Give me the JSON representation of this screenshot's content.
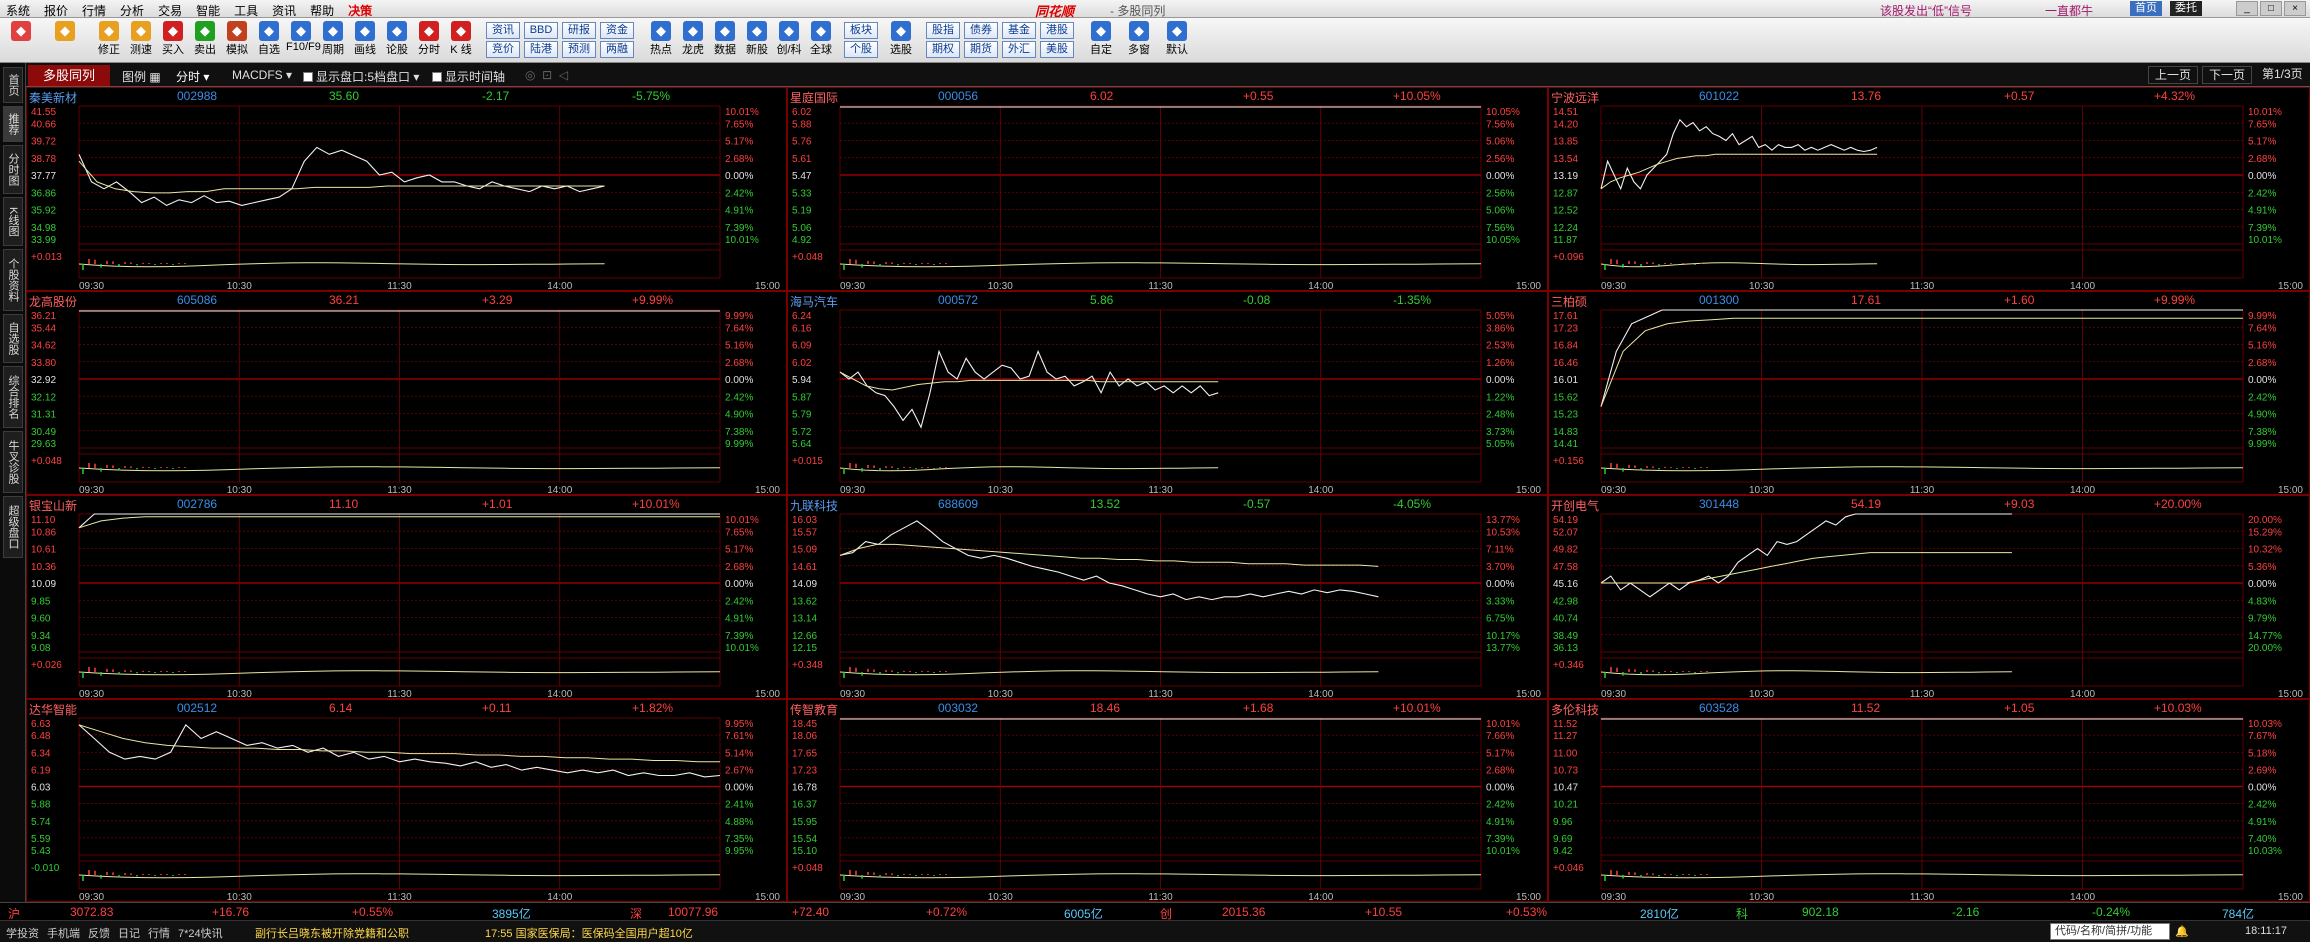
{
  "menubar": {
    "items": [
      "系统",
      "报价",
      "行情",
      "分析",
      "交易",
      "智能",
      "工具",
      "资讯",
      "帮助",
      "决策"
    ],
    "brand": "同花顺",
    "title": "- 多股同列",
    "alert": "该股发出“低”信号",
    "alert2": "一直都牛",
    "chip1": "首页",
    "chip2": "委托"
  },
  "toolbar": {
    "icons": [
      {
        "label": "",
        "name": "color-grid-icon"
      },
      {
        "label": "",
        "name": "back-arrow-icon"
      },
      {
        "label": "修正",
        "name": "fix-icon"
      },
      {
        "label": "测速",
        "name": "speed-test-icon"
      },
      {
        "label": "买入",
        "name": "buy-icon"
      },
      {
        "label": "卖出",
        "name": "sell-icon"
      },
      {
        "label": "模拟",
        "name": "simulate-icon"
      },
      {
        "label": "自选",
        "name": "watchlist-icon"
      },
      {
        "label": "F10/F9",
        "name": "f10-icon"
      },
      {
        "label": "周期",
        "name": "period-icon"
      },
      {
        "label": "画线",
        "name": "draw-line-icon"
      },
      {
        "label": "论股",
        "name": "discuss-icon"
      },
      {
        "label": "分时",
        "name": "intraday-icon"
      },
      {
        "label": "K 线",
        "name": "kline-icon"
      }
    ],
    "boxes1": [
      "资讯",
      "竞价",
      "BBD",
      "陆港",
      "研报",
      "预测",
      "资金",
      "两融"
    ],
    "icons2": [
      {
        "label": "热点",
        "name": "hot-icon"
      },
      {
        "label": "龙虎",
        "name": "dragon-tiger-icon"
      },
      {
        "label": "数据",
        "name": "data-icon"
      },
      {
        "label": "新股",
        "name": "new-stock-icon"
      },
      {
        "label": "创/科",
        "name": "chuang-ke-icon"
      },
      {
        "label": "全球",
        "name": "global-icon"
      }
    ],
    "boxes2": [
      "板块",
      "个股"
    ],
    "xuangu": "选股",
    "boxes3": [
      "股指",
      "期权",
      "债券",
      "期货",
      "基金",
      "外汇",
      "港股",
      "美股"
    ],
    "icons3": [
      {
        "label": "自定",
        "name": "custom-icon"
      },
      {
        "label": "多窗",
        "name": "multi-window-icon"
      },
      {
        "label": "默认",
        "name": "default-home-icon"
      }
    ]
  },
  "tabbar": {
    "main_tab": "多股同列",
    "layout": "图例",
    "period": "分时",
    "indicator": "MACDFS",
    "opt1": "显示盘口:5档盘口",
    "opt2": "显示时间轴",
    "prev": "上一页",
    "next": "下一页",
    "page": "第1/3页"
  },
  "sidebar": [
    "首页",
    "推荐",
    "分时图",
    "K线图",
    "个股资料",
    "自选股",
    "综合排名",
    "牛叉诊股",
    "超级盘口"
  ],
  "time_labels": [
    "09:30",
    "10:30",
    "11:30",
    "14:00",
    "15:00"
  ],
  "colors": {
    "up": "#ff4040",
    "down": "#33cc33",
    "neutral": "#e0e0e0",
    "code": "#3a8ee6",
    "name": "#5a9bf0",
    "grid": "#7a0000"
  },
  "stocks": [
    {
      "name": "秦美新材",
      "code": "002988",
      "price": "35.60",
      "change": "-2.17",
      "pct": "-5.75%",
      "ticks": [
        "41.55",
        "40.66",
        "39.72",
        "38.78",
        "37.77",
        "36.86",
        "35.92",
        "34.98",
        "33.99"
      ],
      "pcts": [
        "10.01%",
        "7.65%",
        "5.17%",
        "2.68%",
        "0.00%",
        "2.42%",
        "4.91%",
        "7.39%",
        "10.01%"
      ],
      "vol": "+0.013",
      "color": "down",
      "shape": [
        0.35,
        0.55,
        0.6,
        0.55,
        0.62,
        0.7,
        0.66,
        0.72,
        0.68,
        0.7,
        0.65,
        0.7,
        0.69,
        0.72,
        0.7,
        0.68,
        0.66,
        0.6,
        0.4,
        0.3,
        0.35,
        0.32,
        0.36,
        0.4,
        0.5,
        0.48,
        0.55,
        0.52,
        0.5,
        0.55,
        0.55,
        0.58,
        0.6,
        0.55,
        0.58,
        0.6,
        0.62,
        0.58,
        0.6,
        0.58,
        0.62,
        0.6,
        0.58
      ],
      "avg": [
        0.4,
        0.55,
        0.6,
        0.62,
        0.63,
        0.63,
        0.62,
        0.62,
        0.6,
        0.6,
        0.6,
        0.6,
        0.6,
        0.59,
        0.59,
        0.59,
        0.59,
        0.58,
        0.58,
        0.58,
        0.58,
        0.58,
        0.58,
        0.58,
        0.58,
        0.58,
        0.58,
        0.58,
        0.58,
        0.58
      ],
      "end": 0.82
    },
    {
      "name": "星庭国际",
      "code": "000056",
      "price": "6.02",
      "change": "+0.55",
      "pct": "+10.05%",
      "ticks": [
        "6.02",
        "5.88",
        "5.76",
        "5.61",
        "5.47",
        "5.33",
        "5.19",
        "5.06",
        "4.92"
      ],
      "pcts": [
        "10.05%",
        "7.56%",
        "5.06%",
        "2.56%",
        "0.00%",
        "2.56%",
        "5.06%",
        "7.56%",
        "10.05%"
      ],
      "vol": "+0.048",
      "color": "up",
      "shape": [],
      "avg": [],
      "end": 1
    },
    {
      "name": "宁波远洋",
      "code": "601022",
      "price": "13.76",
      "change": "+0.57",
      "pct": "+4.32%",
      "ticks": [
        "14.51",
        "14.20",
        "13.85",
        "13.54",
        "13.19",
        "12.87",
        "12.52",
        "12.24",
        "11.87"
      ],
      "pcts": [
        "10.01%",
        "7.65%",
        "5.17%",
        "2.68%",
        "0.00%",
        "2.42%",
        "4.91%",
        "7.39%",
        "10.01%"
      ],
      "vol": "+0.096",
      "color": "up",
      "shape": [
        0.6,
        0.4,
        0.5,
        0.6,
        0.45,
        0.55,
        0.6,
        0.5,
        0.45,
        0.4,
        0.35,
        0.2,
        0.1,
        0.15,
        0.12,
        0.18,
        0.15,
        0.2,
        0.22,
        0.25,
        0.2,
        0.28,
        0.25,
        0.22,
        0.3,
        0.28,
        0.32,
        0.28,
        0.3,
        0.3,
        0.28,
        0.32,
        0.3,
        0.32,
        0.3,
        0.28,
        0.3,
        0.32,
        0.3,
        0.32,
        0.33,
        0.32,
        0.3
      ],
      "avg": [
        0.6,
        0.55,
        0.52,
        0.5,
        0.48,
        0.45,
        0.42,
        0.4,
        0.38,
        0.37,
        0.36,
        0.36,
        0.35,
        0.35,
        0.35,
        0.35,
        0.35,
        0.35,
        0.35,
        0.35,
        0.35,
        0.35,
        0.35,
        0.35,
        0.35,
        0.35,
        0.35,
        0.35,
        0.35,
        0.35
      ],
      "end": 0.43
    },
    {
      "name": "龙高股份",
      "code": "605086",
      "price": "36.21",
      "change": "+3.29",
      "pct": "+9.99%",
      "ticks": [
        "36.21",
        "35.44",
        "34.62",
        "33.80",
        "32.92",
        "32.12",
        "31.31",
        "30.49",
        "29.63"
      ],
      "pcts": [
        "9.99%",
        "7.64%",
        "5.16%",
        "2.68%",
        "0.00%",
        "2.42%",
        "4.90%",
        "7.38%",
        "9.99%"
      ],
      "vol": "+0.048",
      "color": "up",
      "shape": [],
      "avg": [],
      "end": 1
    },
    {
      "name": "海马汽车",
      "code": "000572",
      "price": "5.86",
      "change": "-0.08",
      "pct": "-1.35%",
      "ticks": [
        "6.24",
        "6.16",
        "6.09",
        "6.02",
        "5.94",
        "5.87",
        "5.79",
        "5.72",
        "5.64"
      ],
      "pcts": [
        "5.05%",
        "3.86%",
        "2.53%",
        "1.26%",
        "0.00%",
        "1.22%",
        "2.48%",
        "3.73%",
        "5.05%"
      ],
      "vol": "+0.015",
      "color": "down",
      "shape": [
        0.45,
        0.5,
        0.45,
        0.55,
        0.6,
        0.62,
        0.7,
        0.8,
        0.72,
        0.85,
        0.6,
        0.3,
        0.45,
        0.5,
        0.35,
        0.45,
        0.5,
        0.45,
        0.4,
        0.42,
        0.5,
        0.48,
        0.3,
        0.45,
        0.5,
        0.48,
        0.55,
        0.52,
        0.48,
        0.6,
        0.45,
        0.55,
        0.5,
        0.55,
        0.52,
        0.58,
        0.55,
        0.6,
        0.55,
        0.6,
        0.55,
        0.62,
        0.6
      ],
      "avg": [
        0.45,
        0.5,
        0.55,
        0.57,
        0.58,
        0.56,
        0.54,
        0.53,
        0.52,
        0.52,
        0.51,
        0.51,
        0.51,
        0.51,
        0.51,
        0.51,
        0.51,
        0.51,
        0.51,
        0.51,
        0.52,
        0.52,
        0.52,
        0.52,
        0.52,
        0.52,
        0.52,
        0.52,
        0.52,
        0.52
      ],
      "end": 0.59
    },
    {
      "name": "三柏硕",
      "code": "001300",
      "price": "17.61",
      "change": "+1.60",
      "pct": "+9.99%",
      "ticks": [
        "17.61",
        "17.23",
        "16.84",
        "16.46",
        "16.01",
        "15.62",
        "15.23",
        "14.83",
        "14.41"
      ],
      "pcts": [
        "9.99%",
        "7.64%",
        "5.16%",
        "2.68%",
        "0.00%",
        "2.42%",
        "4.90%",
        "7.38%",
        "9.99%"
      ],
      "vol": "+0.156",
      "color": "up",
      "shape": [
        0.7,
        0.3,
        0.1,
        0.05,
        0.0,
        0.0,
        0.0,
        0.0,
        0.0,
        0.0,
        0.0,
        0.0,
        0.0,
        0.0,
        0.0,
        0.0,
        0.0,
        0.0,
        0.0,
        0.0,
        0.0,
        0.0,
        0.0,
        0.0,
        0.0,
        0.0,
        0.0,
        0.0,
        0.0,
        0.0,
        0.0,
        0.0,
        0.0,
        0.0,
        0.0,
        0.0,
        0.0,
        0.0,
        0.0,
        0.0,
        0.0,
        0.0,
        0.0
      ],
      "avg": [
        0.7,
        0.3,
        0.15,
        0.1,
        0.08,
        0.07,
        0.06,
        0.06,
        0.06,
        0.06,
        0.06,
        0.06,
        0.06,
        0.06,
        0.06,
        0.06,
        0.06,
        0.06,
        0.06,
        0.06,
        0.06,
        0.06,
        0.06,
        0.06,
        0.06,
        0.06,
        0.06,
        0.06,
        0.06,
        0.06
      ],
      "end": 1
    },
    {
      "name": "银宝山新",
      "code": "002786",
      "price": "11.10",
      "change": "+1.01",
      "pct": "+10.01%",
      "ticks": [
        "11.10",
        "10.86",
        "10.61",
        "10.36",
        "10.09",
        "9.85",
        "9.60",
        "9.34",
        "9.08"
      ],
      "pcts": [
        "10.01%",
        "7.65%",
        "5.17%",
        "2.68%",
        "0.00%",
        "2.42%",
        "4.91%",
        "7.39%",
        "10.01%"
      ],
      "vol": "+0.026",
      "color": "up",
      "shape": [
        0.1,
        0.0,
        0.0,
        0.0,
        0.0,
        0.0,
        0.0,
        0.0,
        0.0,
        0.0,
        0.0,
        0.0,
        0.0,
        0.0,
        0.0,
        0.0,
        0.0,
        0.0,
        0.0,
        0.0,
        0.0,
        0.0,
        0.0,
        0.0,
        0.0,
        0.0,
        0.0,
        0.0,
        0.0,
        0.0,
        0.0,
        0.0,
        0.0,
        0.0,
        0.0,
        0.0,
        0.0,
        0.0,
        0.0,
        0.0,
        0.0,
        0.0,
        0.0
      ],
      "avg": [
        0.1,
        0.05,
        0.03,
        0.02,
        0.02,
        0.02,
        0.02,
        0.02,
        0.02,
        0.02,
        0.02,
        0.02,
        0.02,
        0.02,
        0.02,
        0.02,
        0.02,
        0.02,
        0.02,
        0.02,
        0.02,
        0.02,
        0.02,
        0.02,
        0.02,
        0.02,
        0.02,
        0.02,
        0.02,
        0.02
      ],
      "end": 1
    },
    {
      "name": "九联科技",
      "code": "688609",
      "price": "13.52",
      "change": "-0.57",
      "pct": "-4.05%",
      "ticks": [
        "16.03",
        "15.57",
        "15.09",
        "14.61",
        "14.09",
        "13.62",
        "13.14",
        "12.66",
        "12.15"
      ],
      "pcts": [
        "13.77%",
        "10.53%",
        "7.11%",
        "3.70%",
        "0.00%",
        "3.33%",
        "6.75%",
        "10.17%",
        "13.77%"
      ],
      "vol": "+0.348",
      "color": "down",
      "shape": [
        0.3,
        0.28,
        0.2,
        0.22,
        0.15,
        0.1,
        0.05,
        0.12,
        0.2,
        0.25,
        0.3,
        0.32,
        0.3,
        0.32,
        0.35,
        0.38,
        0.4,
        0.42,
        0.45,
        0.48,
        0.45,
        0.5,
        0.52,
        0.55,
        0.58,
        0.6,
        0.58,
        0.62,
        0.6,
        0.62,
        0.6,
        0.6,
        0.58,
        0.6,
        0.58,
        0.56,
        0.58,
        0.55,
        0.57,
        0.55,
        0.56,
        0.58,
        0.6
      ],
      "avg": [
        0.3,
        0.25,
        0.22,
        0.22,
        0.23,
        0.24,
        0.25,
        0.26,
        0.27,
        0.28,
        0.29,
        0.3,
        0.31,
        0.32,
        0.32,
        0.33,
        0.33,
        0.34,
        0.34,
        0.35,
        0.35,
        0.35,
        0.36,
        0.36,
        0.36,
        0.37,
        0.37,
        0.37,
        0.37,
        0.38
      ],
      "end": 0.84
    },
    {
      "name": "开创电气",
      "code": "301448",
      "price": "54.19",
      "change": "+9.03",
      "pct": "+20.00%",
      "ticks": [
        "54.19",
        "52.07",
        "49.82",
        "47.58",
        "45.16",
        "42.98",
        "40.74",
        "38.49",
        "36.13"
      ],
      "pcts": [
        "20.00%",
        "15.29%",
        "10.32%",
        "5.36%",
        "0.00%",
        "4.83%",
        "9.79%",
        "14.77%",
        "20.00%"
      ],
      "vol": "+0.346",
      "color": "up",
      "shape": [
        0.5,
        0.45,
        0.55,
        0.5,
        0.55,
        0.6,
        0.55,
        0.5,
        0.55,
        0.5,
        0.48,
        0.45,
        0.5,
        0.45,
        0.35,
        0.3,
        0.25,
        0.3,
        0.2,
        0.22,
        0.2,
        0.15,
        0.1,
        0.05,
        0.08,
        0.02,
        0.0,
        0.0,
        0.0,
        0.0,
        0.0,
        0.0,
        0.0,
        0.0,
        0.0,
        0.0,
        0.0,
        0.0,
        0.0,
        0.0,
        0.0,
        0.0,
        0.0
      ],
      "avg": [
        0.5,
        0.5,
        0.5,
        0.5,
        0.5,
        0.5,
        0.5,
        0.48,
        0.46,
        0.44,
        0.42,
        0.4,
        0.38,
        0.36,
        0.34,
        0.32,
        0.31,
        0.3,
        0.29,
        0.28,
        0.28,
        0.28,
        0.28,
        0.28,
        0.28,
        0.28,
        0.28,
        0.28,
        0.28,
        0.28
      ],
      "end": 0.64
    },
    {
      "name": "达华智能",
      "code": "002512",
      "price": "6.14",
      "change": "+0.11",
      "pct": "+1.82%",
      "ticks": [
        "6.63",
        "6.48",
        "6.34",
        "6.19",
        "6.03",
        "5.88",
        "5.74",
        "5.59",
        "5.43"
      ],
      "pcts": [
        "9.95%",
        "7.61%",
        "5.14%",
        "2.67%",
        "0.00%",
        "2.41%",
        "4.88%",
        "7.35%",
        "9.95%"
      ],
      "vol": "-0.010",
      "color": "up",
      "shape": [
        0.05,
        0.15,
        0.25,
        0.3,
        0.28,
        0.3,
        0.25,
        0.05,
        0.15,
        0.1,
        0.15,
        0.2,
        0.18,
        0.22,
        0.2,
        0.25,
        0.22,
        0.28,
        0.25,
        0.3,
        0.28,
        0.32,
        0.3,
        0.32,
        0.33,
        0.35,
        0.32,
        0.36,
        0.34,
        0.38,
        0.36,
        0.38,
        0.4,
        0.38,
        0.4,
        0.38,
        0.42,
        0.4,
        0.42,
        0.42,
        0.4,
        0.43,
        0.42
      ],
      "avg": [
        0.05,
        0.1,
        0.15,
        0.18,
        0.2,
        0.21,
        0.22,
        0.22,
        0.22,
        0.23,
        0.23,
        0.24,
        0.24,
        0.25,
        0.25,
        0.26,
        0.26,
        0.26,
        0.27,
        0.27,
        0.28,
        0.28,
        0.29,
        0.29,
        0.3,
        0.3,
        0.31,
        0.31,
        0.32,
        0.32
      ],
      "end": 1
    },
    {
      "name": "传智教育",
      "code": "003032",
      "price": "18.46",
      "change": "+1.68",
      "pct": "+10.01%",
      "ticks": [
        "18.45",
        "18.06",
        "17.65",
        "17.23",
        "16.78",
        "16.37",
        "15.95",
        "15.54",
        "15.10"
      ],
      "pcts": [
        "10.01%",
        "7.66%",
        "5.17%",
        "2.68%",
        "0.00%",
        "2.42%",
        "4.91%",
        "7.39%",
        "10.01%"
      ],
      "vol": "+0.048",
      "color": "up",
      "shape": [],
      "avg": [],
      "end": 1
    },
    {
      "name": "多伦科技",
      "code": "603528",
      "price": "11.52",
      "change": "+1.05",
      "pct": "+10.03%",
      "ticks": [
        "11.52",
        "11.27",
        "11.00",
        "10.73",
        "10.47",
        "10.21",
        "9.96",
        "9.69",
        "9.42"
      ],
      "pcts": [
        "10.03%",
        "7.67%",
        "5.18%",
        "2.69%",
        "0.00%",
        "2.42%",
        "4.91%",
        "7.40%",
        "10.03%"
      ],
      "vol": "+0.046",
      "color": "up",
      "shape": [],
      "avg": [],
      "end": 1
    }
  ],
  "status": {
    "sh_label": "沪",
    "sh_index": "3072.83",
    "sh_chg": "+16.76",
    "sh_pct": "+0.55%",
    "sh_amt": "3895亿",
    "sz_label": "深",
    "sz_index": "10077.96",
    "sz_chg": "+72.40",
    "sz_pct": "+0.72%",
    "sz_amt": "6005亿",
    "cy_label": "创",
    "cy_index": "2015.36",
    "cy_chg": "+10.55",
    "cy_pct": "+0.53%",
    "cy_amt": "2810亿",
    "kc_label": "科",
    "kc_index": "902.18",
    "kc_chg": "-2.16",
    "kc_pct": "-0.24%",
    "kc_amt": "784亿"
  },
  "statusbar2": {
    "links": [
      "学投资",
      "手机端",
      "反馈",
      "日记",
      "行情",
      "7*24快讯"
    ],
    "news1": "副行长吕晓东被开除党籍和公职",
    "news2": "17:55 国家医保局：医保码全国用户超10亿",
    "search_placeholder": "代码/名称/简拼/功能",
    "time": "18:11:17"
  }
}
